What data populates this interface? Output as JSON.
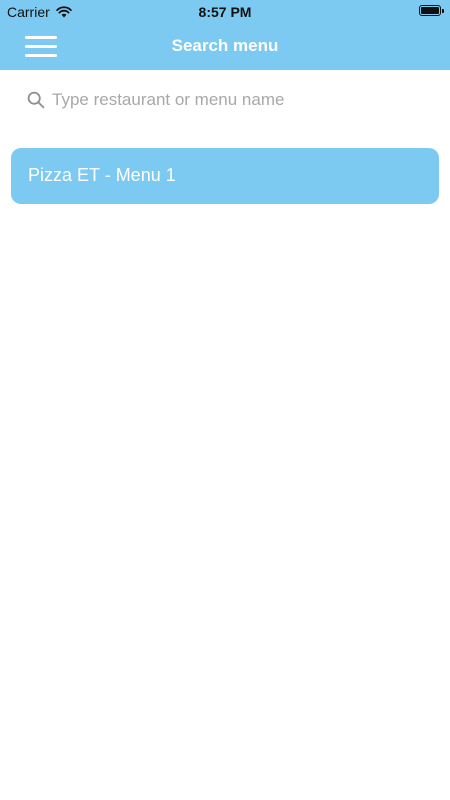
{
  "status_bar": {
    "carrier": "Carrier",
    "time": "8:57 PM"
  },
  "header": {
    "title": "Search menu",
    "menu_icon": "hamburger-menu-icon",
    "background_color": "#7ccaf1"
  },
  "search": {
    "placeholder": "Type restaurant or menu name",
    "value": "",
    "icon": "search-icon"
  },
  "results": [
    {
      "label": "Pizza ET - Menu 1"
    }
  ]
}
